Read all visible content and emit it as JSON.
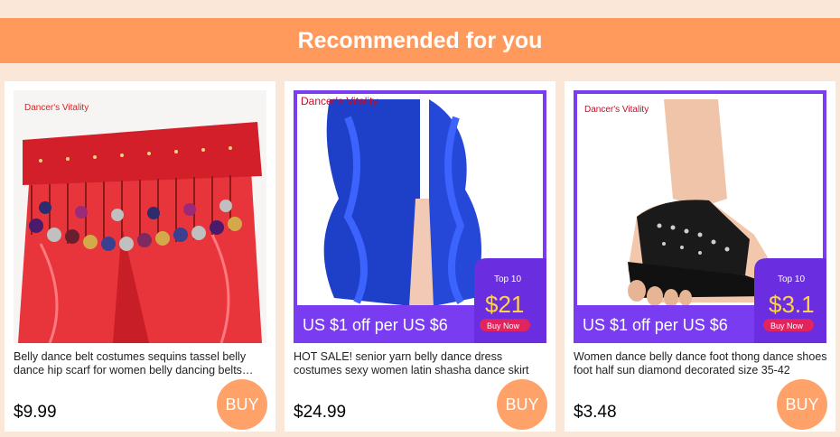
{
  "header": {
    "title": "Recommended for you"
  },
  "products": [
    {
      "brand_watermark": "Dancer's Vitality",
      "title": "Belly dance belt costumes sequins tassel belly dance hip scarf for women belly dancing belts thailand/india/arab dancer skirt show",
      "price": "$9.99",
      "buy_label": "BUY"
    },
    {
      "brand_watermark": "Dancer's Vitality",
      "promo_text": "US $1 off per US $6",
      "badge_top": "Top 10",
      "badge_price": "$21",
      "badge_cta": "Buy Now",
      "title": "HOT SALE! senior yarn belly dance dress costumes sexy women latin shasha dance skirt",
      "price": "$24.99",
      "buy_label": "BUY"
    },
    {
      "brand_watermark": "Dancer's Vitality",
      "promo_text": "US $1 off per US $6",
      "badge_top": "Top 10",
      "badge_price": "$3.1",
      "badge_cta": "Buy Now",
      "title": "Women dance belly dance foot thong dance shoes foot half sun diamond decorated size 35-42",
      "price": "$3.48",
      "buy_label": "BUY"
    }
  ],
  "colors": {
    "page_bg": "#fbe7d8",
    "banner": "#ff9a5c",
    "buy_button": "#ffa26a",
    "promo_frame": "#7a3cf0",
    "badge_cta": "#e0245e"
  }
}
